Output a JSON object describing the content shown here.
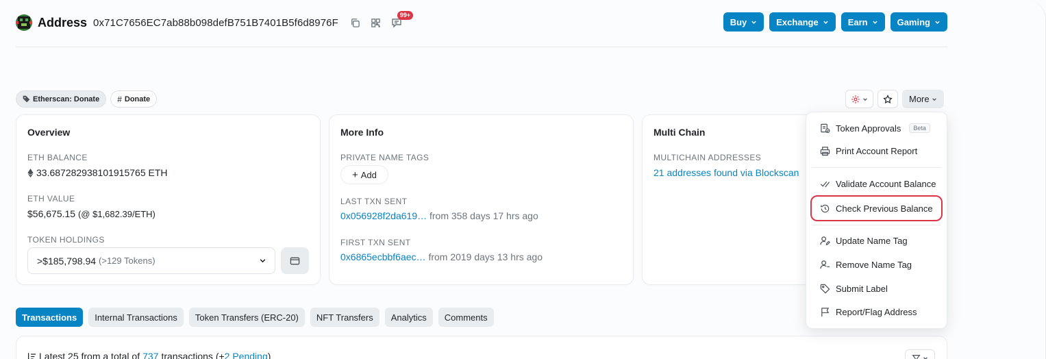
{
  "header": {
    "title": "Address",
    "address": "0x71C7656EC7ab88b098defB751B7401B5f6d8976F",
    "notification_badge": "99+",
    "nav": [
      "Buy",
      "Exchange",
      "Earn",
      "Gaming"
    ]
  },
  "tags": {
    "label_tag": "Etherscan: Donate",
    "hash_tag": "Donate"
  },
  "tools": {
    "more_label": "More"
  },
  "overview": {
    "title": "Overview",
    "eth_balance_label": "ETH BALANCE",
    "eth_balance_value": "33.687282938101915765 ETH",
    "eth_value_label": "ETH VALUE",
    "eth_value_amount": "$56,675.15",
    "eth_value_rate": "(@ $1,682.39/ETH)",
    "token_holdings_label": "TOKEN HOLDINGS",
    "token_holdings_value": ">$185,798.94",
    "token_holdings_count": "(>129 Tokens)"
  },
  "more_info": {
    "title": "More Info",
    "private_tags_label": "PRIVATE NAME TAGS",
    "add_label": "Add",
    "last_txn_label": "LAST TXN SENT",
    "last_txn_hash": "0x056928f2da619…",
    "last_txn_age": "from 358 days 17 hrs ago",
    "first_txn_label": "FIRST TXN SENT",
    "first_txn_hash": "0x6865ecbbf6aec…",
    "first_txn_age": "from 2019 days 13 hrs ago"
  },
  "multi_chain": {
    "title": "Multi Chain",
    "addresses_label": "MULTICHAIN ADDRESSES",
    "addresses_link": "21 addresses found via Blockscan"
  },
  "dropdown": {
    "token_approvals": "Token Approvals",
    "beta": "Beta",
    "print_report": "Print Account Report",
    "validate_balance": "Validate Account Balance",
    "check_previous": "Check Previous Balance",
    "update_name_tag": "Update Name Tag",
    "remove_name_tag": "Remove Name Tag",
    "submit_label": "Submit Label",
    "report_flag": "Report/Flag Address"
  },
  "tabs": [
    "Transactions",
    "Internal Transactions",
    "Token Transfers (ERC-20)",
    "NFT Transfers",
    "Analytics",
    "Comments"
  ],
  "txn_summary": {
    "prefix": "Latest 25 from a total of",
    "total": "737",
    "middle": "transactions (+",
    "pending": "2 Pending",
    "suffix": ")"
  },
  "colors": {
    "accent": "#0784c3",
    "danger": "#dc3545",
    "muted": "#6c757d"
  }
}
